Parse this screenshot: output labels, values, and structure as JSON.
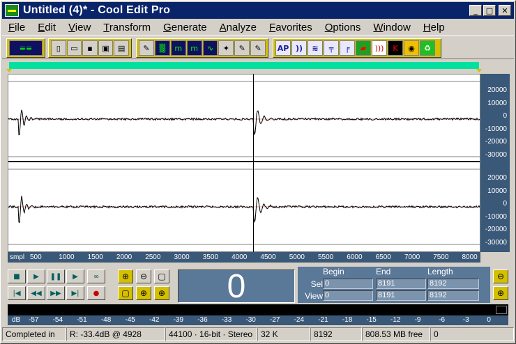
{
  "window": {
    "title": "Untitled (4)* - Cool Edit Pro",
    "minimize": "_",
    "maximize": "□",
    "close": "✕"
  },
  "menu": [
    "File",
    "Edit",
    "View",
    "Transform",
    "Generate",
    "Analyze",
    "Favorites",
    "Options",
    "Window",
    "Help"
  ],
  "menu_underline": [
    "F",
    "E",
    "V",
    "T",
    "G",
    "A",
    "F",
    "O",
    "W",
    "H"
  ],
  "toolbar": {
    "groups": [
      {
        "icons": [
          "multitrack-icon"
        ]
      },
      {
        "icons": [
          "new-file-icon",
          "open-file-icon",
          "save-icon",
          "save-all-icon",
          "save-selection-icon"
        ]
      },
      {
        "icons": [
          "edit-icon",
          "noise-icon",
          "mix-icon",
          "mix-paste-icon",
          "waveform-icon",
          "wand-icon",
          "generate-icon",
          "envelope-icon"
        ]
      },
      {
        "icons": [
          "ap-icon",
          "phaser-icon",
          "chorus-icon",
          "graphic-eq-icon",
          "filter-icon",
          "red-green-icon",
          "sonar-icon",
          "noise-gate-icon",
          "pan-icon",
          "recycle-icon"
        ]
      }
    ]
  },
  "waveform": {
    "amp_labels": [
      "20000",
      "10000",
      "0",
      "-10000",
      "-20000",
      "-30000"
    ],
    "time_unit": "smpl",
    "time_labels": [
      "500",
      "1000",
      "1500",
      "2000",
      "2500",
      "3000",
      "3500",
      "4000",
      "4500",
      "5000",
      "5500",
      "6000",
      "6500",
      "7000",
      "7500",
      "8000"
    ]
  },
  "time_display": "0",
  "selection": {
    "headers": [
      "Begin",
      "End",
      "Length"
    ],
    "sel_label": "Sel",
    "view_label": "View",
    "sel": [
      "0",
      "8191",
      "8192"
    ],
    "view": [
      "0",
      "8191",
      "8192"
    ]
  },
  "meter": {
    "unit": "dB",
    "labels": [
      "-57",
      "-54",
      "-51",
      "-48",
      "-45",
      "-42",
      "-39",
      "-36",
      "-33",
      "-30",
      "-27",
      "-24",
      "-21",
      "-18",
      "-15",
      "-12",
      "-9",
      "-6",
      "-3",
      "0"
    ]
  },
  "status": {
    "completed": "Completed in",
    "level": "R: -33.4dB @ 4928",
    "format": "44100 · 16-bit · Stereo",
    "size": "32 K",
    "samples": "8192",
    "free": "808.53 MB free",
    "last": "0"
  },
  "colors": {
    "titlebar": "#0a246a",
    "overview": "#00e0a0",
    "ruler": "#3a5878",
    "panel": "#5a7898"
  }
}
